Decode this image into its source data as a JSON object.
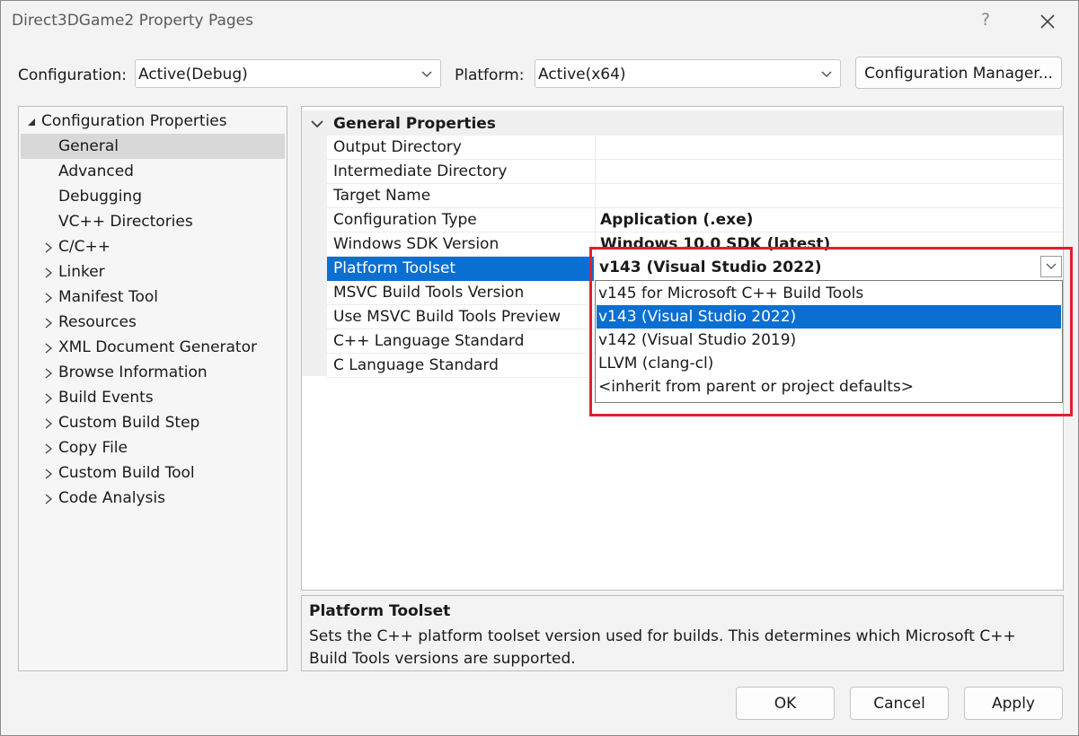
{
  "window": {
    "title": "Direct3DGame2 Property Pages",
    "help_label": "?"
  },
  "config_row": {
    "configuration_label": "Configuration:",
    "configuration_value": "Active(Debug)",
    "platform_label": "Platform:",
    "platform_value": "Active(x64)",
    "config_manager_label": "Configuration Manager..."
  },
  "tree": {
    "root": "Configuration Properties",
    "children": [
      "General",
      "Advanced",
      "Debugging",
      "VC++ Directories"
    ],
    "collapsed": [
      "C/C++",
      "Linker",
      "Manifest Tool",
      "Resources",
      "XML Document Generator",
      "Browse Information",
      "Build Events",
      "Custom Build Step",
      "Copy File",
      "Custom Build Tool",
      "Code Analysis"
    ],
    "selected": "General"
  },
  "grid": {
    "category": "General Properties",
    "rows": [
      {
        "name": "Output Directory",
        "value": ""
      },
      {
        "name": "Intermediate Directory",
        "value": ""
      },
      {
        "name": "Target Name",
        "value": ""
      },
      {
        "name": "Configuration Type",
        "value": "Application (.exe)"
      },
      {
        "name": "Windows SDK Version",
        "value": "Windows 10.0 SDK (latest)"
      },
      {
        "name": "Platform Toolset",
        "value": ""
      },
      {
        "name": "MSVC Build Tools Version",
        "value": ""
      },
      {
        "name": "Use MSVC Build Tools Preview",
        "value": ""
      },
      {
        "name": "C++ Language Standard",
        "value": ""
      },
      {
        "name": "C Language Standard",
        "value": ""
      }
    ],
    "selected_value": "v143 (Visual Studio 2022)"
  },
  "dropdown": {
    "options": [
      "v145 for Microsoft C++ Build Tools",
      "v143 (Visual Studio 2022)",
      "v142 (Visual Studio 2019)",
      "LLVM (clang-cl)",
      "<inherit from parent or project defaults>"
    ]
  },
  "description": {
    "title": "Platform Toolset",
    "text": "Sets the C++ platform toolset version used for builds. This determines which Microsoft C++ Build Tools versions are supported."
  },
  "footer": {
    "ok_label": "OK",
    "cancel_label": "Cancel",
    "apply_label": "Apply"
  },
  "colors": {
    "selection": "#0a6fd1",
    "highlight_border": "#e0202a"
  }
}
